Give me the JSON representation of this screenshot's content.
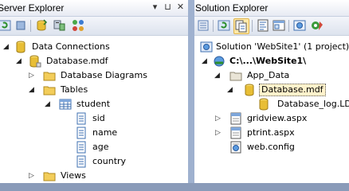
{
  "server_explorer": {
    "title": "Server Explorer",
    "pin_glyph": "▾",
    "dock_glyph": "⊔",
    "close_glyph": "✕",
    "nodes": {
      "data_connections": "Data Connections",
      "database": "Database.mdf",
      "database_diagrams": "Database Diagrams",
      "tables": "Tables",
      "student": "student",
      "sid": "sid",
      "name": "name",
      "age": "age",
      "country": "country",
      "views": "Views"
    }
  },
  "solution_explorer": {
    "title": "Solution Explorer",
    "nodes": {
      "solution": "Solution 'WebSite1' (1 project)",
      "website": "C:\\...\\WebSite1\\",
      "app_data": "App_Data",
      "database": "Database.mdf",
      "database_log": "Database_log.LDF",
      "gridview": "gridview.aspx",
      "ptrint": "ptrint.aspx",
      "web_config": "web.config"
    }
  },
  "glyphs": {
    "expanded": "◢",
    "collapsed": "▷"
  },
  "colors": {
    "selection_fill": "#fff3cc",
    "folder": "#f3cd5a",
    "database": "#e6b92e"
  }
}
